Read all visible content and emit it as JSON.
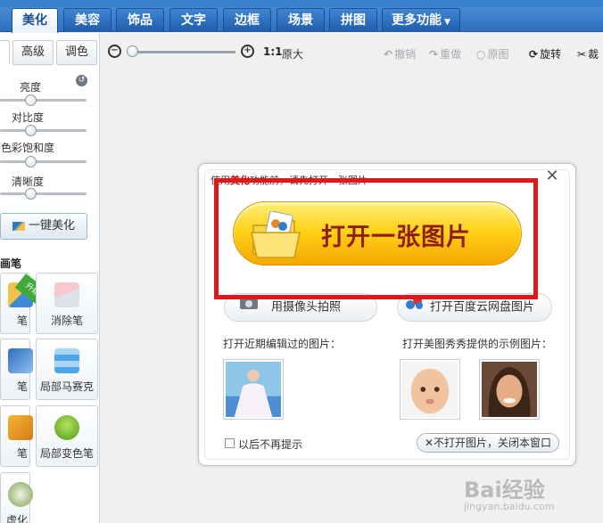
{
  "tabs": [
    {
      "label": "美化",
      "active": true
    },
    {
      "label": "美容",
      "active": false
    },
    {
      "label": "饰品",
      "active": false
    },
    {
      "label": "文字",
      "active": false
    },
    {
      "label": "边框",
      "active": false
    },
    {
      "label": "场景",
      "active": false
    },
    {
      "label": "拼图",
      "active": false
    },
    {
      "label": "更多功能",
      "active": false
    }
  ],
  "left": {
    "subtabs": [
      "高级",
      "调色"
    ],
    "sliders": [
      {
        "label": "亮度",
        "level": 0.35
      },
      {
        "label": "对比度",
        "level": 0.35
      },
      {
        "label": "色彩饱和度",
        "level": 0.35
      },
      {
        "label": "清晰度",
        "level": 0.35
      }
    ],
    "auto_button": "一键美化",
    "brush_section": "画笔",
    "upgrade_badge": "升级",
    "tools": [
      {
        "label": "笔",
        "icon": "pencil-icon"
      },
      {
        "label": "消除笔",
        "icon": "eraser-icon"
      },
      {
        "label": "笔",
        "icon": "eyedropper-icon"
      },
      {
        "label": "局部马赛克",
        "icon": "mosaic-icon"
      },
      {
        "label": "笔",
        "icon": "color-brush-icon"
      },
      {
        "label": "局部变色笔",
        "icon": "color-change-icon"
      },
      {
        "label": "虚化",
        "icon": "blur-icon"
      }
    ]
  },
  "toolbar": {
    "ratio": "1:1",
    "original": "原大",
    "undo": "撤销",
    "redo": "重做",
    "original_image": "原图",
    "rotate": "旋转",
    "crop": "裁"
  },
  "dialog": {
    "hint_prefix": "使用",
    "hint_highlight": "美化",
    "hint_suffix": "功能前，请先打开一张图片",
    "open_button": "打开一张图片",
    "camera_button": "用摄像头拍照",
    "cloud_button": "打开百度云网盘图片",
    "recent_label": "打开近期编辑过的图片：",
    "samples_label": "打开美图秀秀提供的示例图片：",
    "no_remind": "以后不再提示",
    "close_button": "不打开图片，关闭本窗口"
  },
  "watermark": {
    "brand": "Bai经验",
    "url": "jingyan.baidu.com"
  }
}
